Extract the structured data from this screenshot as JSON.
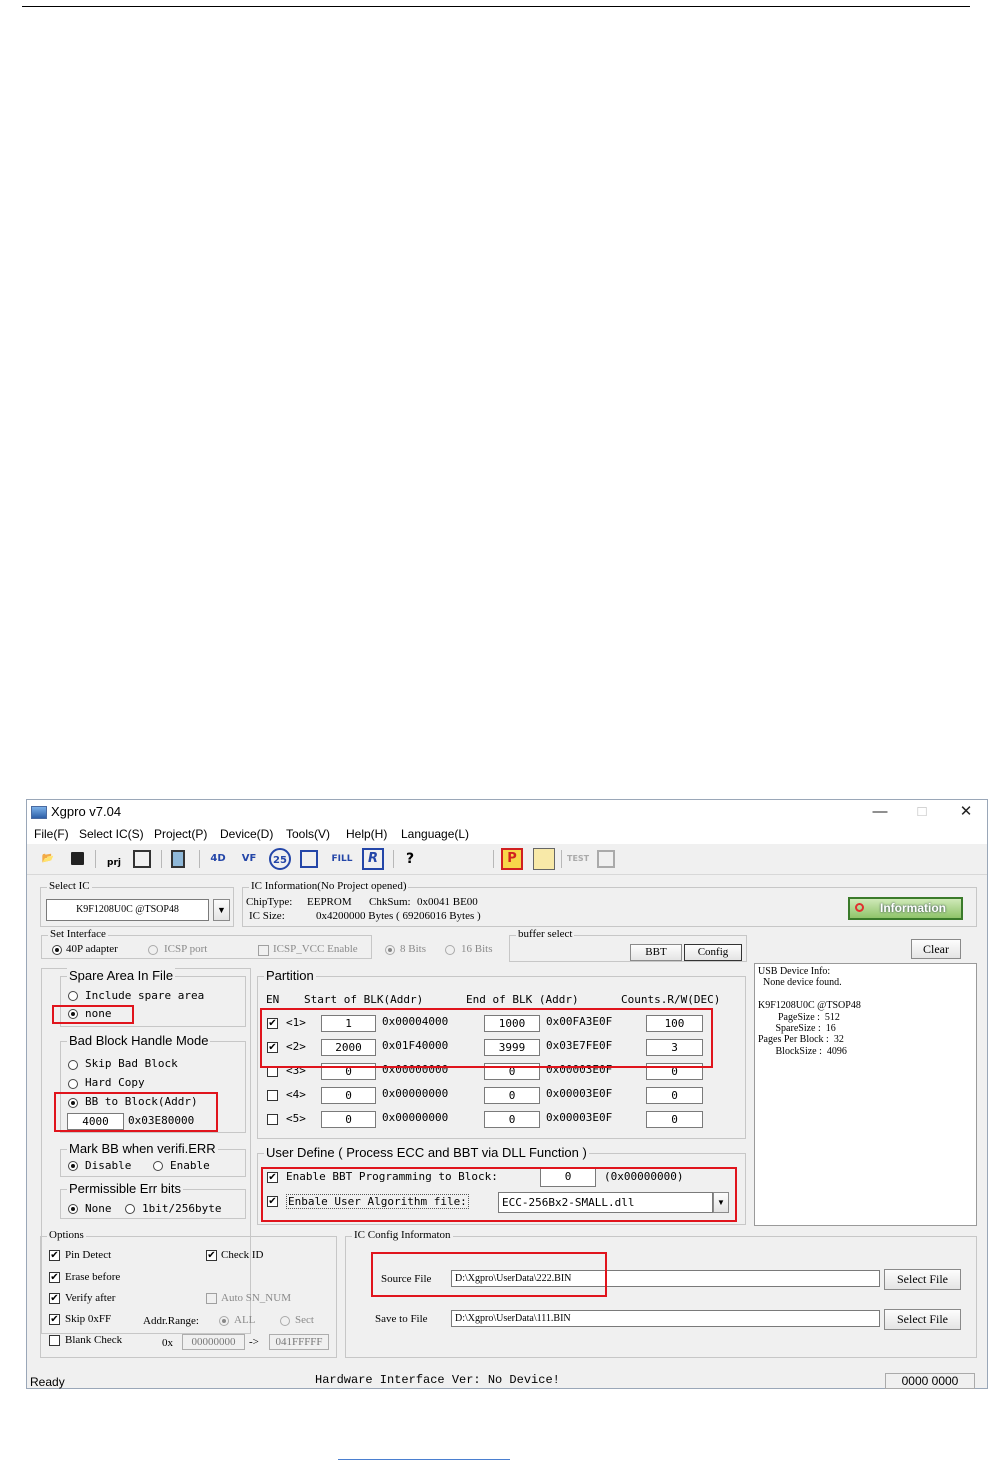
{
  "window": {
    "title": "Xgpro v7.04",
    "minimize": "—",
    "maximize": "□",
    "close": "✕"
  },
  "menu": [
    "File(F)",
    "Select IC(S)",
    "Project(P)",
    "Device(D)",
    "Tools(V)",
    "Help(H)",
    "Language(L)"
  ],
  "toolbar": {
    "icons": [
      "open-icon",
      "save-icon",
      "save-project-icon",
      "load-project-icon",
      "chip-info-icon",
      "read-icon",
      "verify-icon",
      "blank-check-icon",
      "erase-icon",
      "fill-icon",
      "program-icon",
      "help-icon",
      "auto-program-icon",
      "edit-buffer-icon",
      "test-icon",
      "ic-test-icon"
    ],
    "labels": {
      "read": "4D",
      "verify": "VF",
      "blank": "25",
      "fill": "FILL",
      "program": "R",
      "help": "?",
      "prj": "prj",
      "auto": "P",
      "test": "TEST"
    }
  },
  "select_ic": {
    "legend": "Select IC",
    "value": "K9F1208U0C @TSOP48"
  },
  "ic_info": {
    "legend": "IC Information(No Project opened)",
    "chip_type_label": "ChipType:",
    "chip_type": "EEPROM",
    "chksum_label": "ChkSum:",
    "chksum": "0x0041 BE00",
    "ic_size_label": "IC Size:",
    "ic_size": "0x4200000 Bytes ( 69206016 Bytes )",
    "information_button": "Information"
  },
  "set_interface": {
    "legend": "Set Interface",
    "adapter": "40P adapter",
    "icsp_port": "ICSP port",
    "icsp_vcc": "ICSP_VCC Enable",
    "bits8": "8 Bits",
    "bits16": "16 Bits"
  },
  "buffer_select": {
    "legend": "buffer select",
    "bbt": "BBT",
    "config": "Config"
  },
  "clear_button": "Clear",
  "usb_info": {
    "lines": [
      "USB Device Info:",
      "  None device found.",
      "",
      "K9F1208U0C @TSOP48",
      "        PageSize :  512",
      "       SpareSize :  16",
      "Pages Per Block :  32",
      "       BlockSize :  4096"
    ]
  },
  "spare_area": {
    "legend": "Spare Area In File",
    "include": "Include spare area",
    "none": "none"
  },
  "bad_block": {
    "legend": "Bad Block Handle Mode",
    "skip": "Skip Bad Block",
    "hard_copy": "Hard Copy",
    "bb_to_block": "BB to Block(Addr)",
    "block_value": "4000",
    "block_addr": "0x03E80000"
  },
  "mark_bb": {
    "legend": "Mark BB when verifi.ERR",
    "disable": "Disable",
    "enable": "Enable"
  },
  "err_bits": {
    "legend": "Permissible Err bits",
    "none": "None",
    "bit": "1bit/256byte"
  },
  "partition": {
    "legend": "Partition",
    "headers": {
      "en": "EN",
      "start": "Start of BLK(Addr)",
      "end": "End of BLK (Addr)",
      "counts": "Counts.R/W(DEC)"
    },
    "rows": [
      {
        "id": "<1>",
        "checked": true,
        "start": "1",
        "start_addr": "0x00004000",
        "end": "1000",
        "end_addr": "0x00FA3E0F",
        "count": "100"
      },
      {
        "id": "<2>",
        "checked": true,
        "start": "2000",
        "start_addr": "0x01F40000",
        "end": "3999",
        "end_addr": "0x03E7FE0F",
        "count": "3"
      },
      {
        "id": "<3>",
        "checked": false,
        "start": "0",
        "start_addr": "0x00000000",
        "end": "0",
        "end_addr": "0x00003E0F",
        "count": "0"
      },
      {
        "id": "<4>",
        "checked": false,
        "start": "0",
        "start_addr": "0x00000000",
        "end": "0",
        "end_addr": "0x00003E0F",
        "count": "0"
      },
      {
        "id": "<5>",
        "checked": false,
        "start": "0",
        "start_addr": "0x00000000",
        "end": "0",
        "end_addr": "0x00003E0F",
        "count": "0"
      }
    ]
  },
  "user_define": {
    "legend": "User Define ( Process ECC and BBT via DLL Function )",
    "bbt_label": "Enable BBT Programming to Block:",
    "bbt_value": "0",
    "bbt_addr": "(0x00000000)",
    "algo_label": "Enbale User Algorithm file:",
    "algo_value": "ECC-256Bx2-SMALL.dll"
  },
  "options": {
    "legend": "Options",
    "pin_detect": "Pin Detect",
    "check_id": "Check ID",
    "erase_before": "Erase before",
    "verify_after": "Verify after",
    "auto_sn": "Auto SN_NUM",
    "skip_ff": "Skip 0xFF",
    "blank_check": "Blank Check",
    "addr_range": "Addr.Range:",
    "all": "ALL",
    "sect": "Sect",
    "ox": "0x",
    "from": "00000000",
    "arrow": "->",
    "to": "041FFFFF"
  },
  "ic_config": {
    "legend": "IC Config Informaton",
    "source_label": "Source File",
    "source_value": "D:\\Xgpro\\UserData\\222.BIN",
    "save_label": "Save to File",
    "save_value": "D:\\Xgpro\\UserData\\111.BIN",
    "select_file": "Select File"
  },
  "status": {
    "ready": "Ready",
    "hardware": "Hardware Interface Ver: No Device!",
    "counter": "0000 0000"
  }
}
